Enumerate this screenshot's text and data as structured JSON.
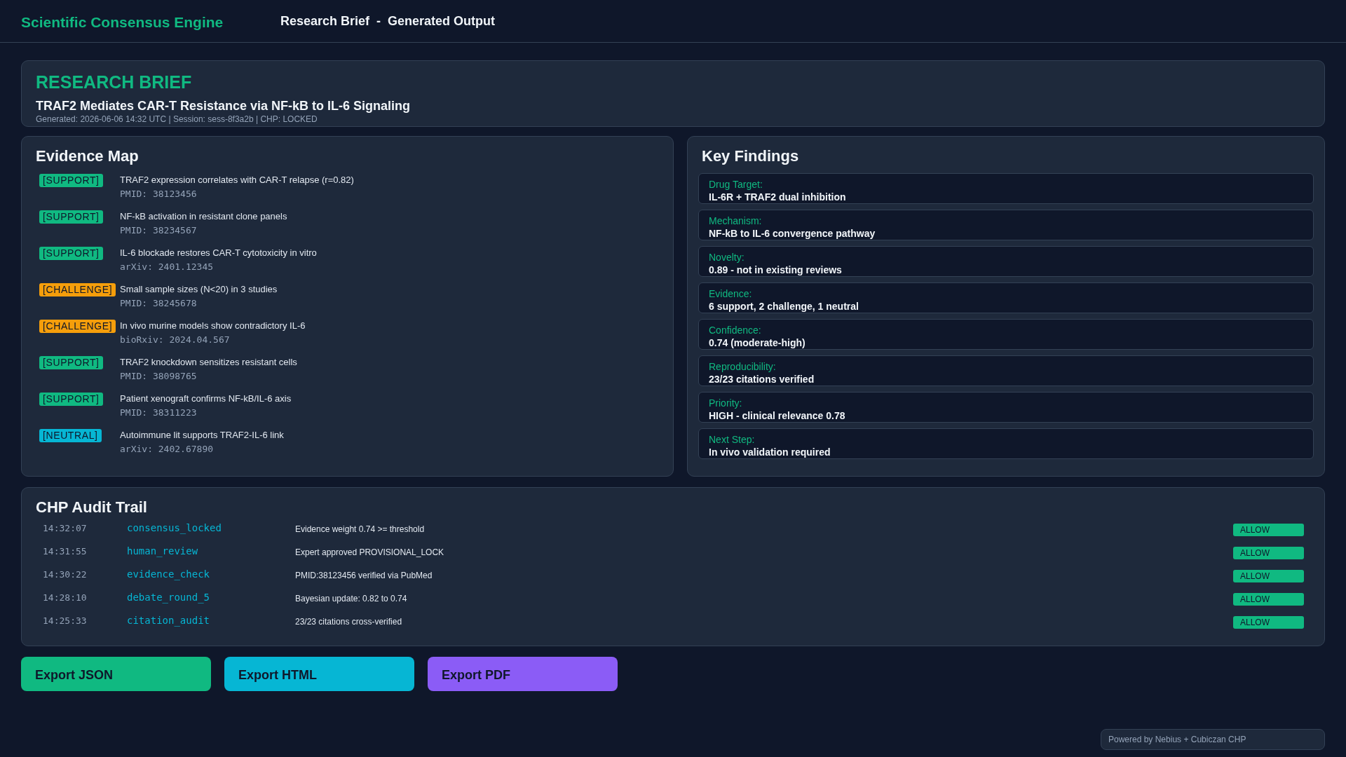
{
  "header": {
    "title": "Scientific Consensus Engine",
    "subtitle": "Research Brief  -  Generated Output"
  },
  "brief": {
    "heading": "RESEARCH BRIEF",
    "title": "TRAF2 Mediates CAR-T Resistance via NF-kB to IL-6 Signaling",
    "meta": "Generated: 2026-06-06 14:32 UTC | Session: sess-8f3a2b | CHP: LOCKED"
  },
  "evidence_map": {
    "title": "Evidence Map",
    "items": [
      {
        "kind": "support",
        "tag": "[SUPPORT]",
        "claim": "TRAF2 expression correlates with CAR-T relapse (r=0.82)",
        "source": "PMID: 38123456"
      },
      {
        "kind": "support",
        "tag": "[SUPPORT]",
        "claim": "NF-kB activation in resistant clone panels",
        "source": "PMID: 38234567"
      },
      {
        "kind": "support",
        "tag": "[SUPPORT]",
        "claim": "IL-6 blockade restores CAR-T cytotoxicity in vitro",
        "source": "arXiv: 2401.12345"
      },
      {
        "kind": "challenge",
        "tag": "[CHALLENGE]",
        "claim": "Small sample sizes (N<20) in 3 studies",
        "source": "PMID: 38245678"
      },
      {
        "kind": "challenge",
        "tag": "[CHALLENGE]",
        "claim": "In vivo murine models show contradictory IL-6",
        "source": "bioRxiv: 2024.04.567"
      },
      {
        "kind": "support",
        "tag": "[SUPPORT]",
        "claim": "TRAF2 knockdown sensitizes resistant cells",
        "source": "PMID: 38098765"
      },
      {
        "kind": "support",
        "tag": "[SUPPORT]",
        "claim": "Patient xenograft confirms NF-kB/IL-6 axis",
        "source": "PMID: 38311223"
      },
      {
        "kind": "neutral",
        "tag": "[NEUTRAL]",
        "claim": "Autoimmune lit supports TRAF2-IL-6 link",
        "source": "arXiv: 2402.67890"
      }
    ]
  },
  "key_findings": {
    "title": "Key Findings",
    "items": [
      {
        "label": "Drug Target:",
        "value": "IL-6R + TRAF2 dual inhibition"
      },
      {
        "label": "Mechanism:",
        "value": "NF-kB to IL-6 convergence pathway"
      },
      {
        "label": "Novelty:",
        "value": "0.89 - not in existing reviews"
      },
      {
        "label": "Evidence:",
        "value": "6 support, 2 challenge, 1 neutral"
      },
      {
        "label": "Confidence:",
        "value": "0.74 (moderate-high)"
      },
      {
        "label": "Reproducibility:",
        "value": "23/23 citations verified"
      },
      {
        "label": "Priority:",
        "value": "HIGH - clinical relevance 0.78"
      },
      {
        "label": "Next Step:",
        "value": "In vivo validation required"
      }
    ]
  },
  "audit_trail": {
    "title": "CHP Audit Trail",
    "rows": [
      {
        "time": "14:32:07",
        "event": "consensus_locked",
        "detail": "Evidence weight 0.74 >= threshold",
        "decision": "ALLOW"
      },
      {
        "time": "14:31:55",
        "event": "human_review",
        "detail": "Expert approved PROVISIONAL_LOCK",
        "decision": "ALLOW"
      },
      {
        "time": "14:30:22",
        "event": "evidence_check",
        "detail": "PMID:38123456 verified via PubMed",
        "decision": "ALLOW"
      },
      {
        "time": "14:28:10",
        "event": "debate_round_5",
        "detail": "Bayesian update: 0.82 to 0.74",
        "decision": "ALLOW"
      },
      {
        "time": "14:25:33",
        "event": "citation_audit",
        "detail": "23/23 citations cross-verified",
        "decision": "ALLOW"
      }
    ]
  },
  "exports": [
    {
      "label": "Export JSON",
      "color": "#10b981"
    },
    {
      "label": "Export HTML",
      "color": "#06b6d4"
    },
    {
      "label": "Export PDF",
      "color": "#8b5cf6"
    }
  ],
  "footer": "Powered by Nebius + Cubiczan CHP"
}
